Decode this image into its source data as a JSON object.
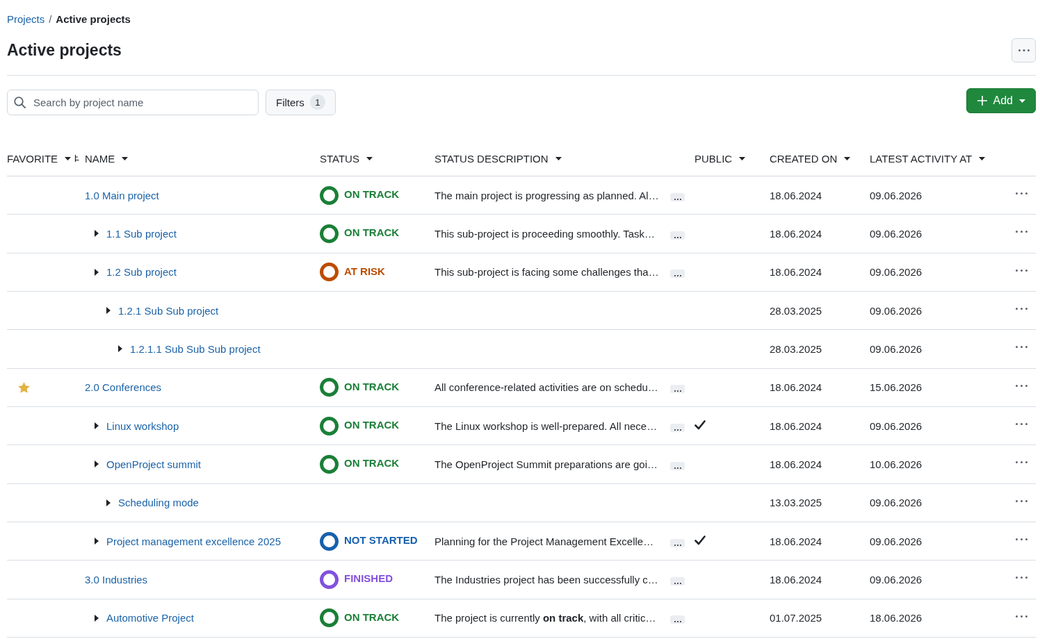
{
  "breadcrumb": {
    "parent": "Projects",
    "separator": "/",
    "current": "Active projects"
  },
  "title": "Active projects",
  "search": {
    "placeholder": "Search by project name"
  },
  "filters": {
    "label": "Filters",
    "count": "1"
  },
  "add_button": {
    "label": "Add"
  },
  "columns": [
    {
      "label": "FAVORITE"
    },
    {
      "label": "NAME"
    },
    {
      "label": "STATUS"
    },
    {
      "label": "STATUS DESCRIPTION"
    },
    {
      "label": "PUBLIC"
    },
    {
      "label": "CREATED ON"
    },
    {
      "label": "LATEST ACTIVITY AT"
    }
  ],
  "projects": [
    {
      "name": "1.0 Main project",
      "favorite": false,
      "status": {
        "label": "ON TRACK",
        "color": "#1a7f37"
      },
      "description": "The main project is progressing as planned. Al…",
      "public": false,
      "created_on": "18.06.2024",
      "latest_activity_at": "09.06.2026",
      "children": [
        {
          "name": "1.1 Sub project",
          "favorite": false,
          "status": {
            "label": "ON TRACK",
            "color": "#1a7f37"
          },
          "description": "This sub-project is proceeding smoothly. Task…",
          "public": false,
          "created_on": "18.06.2024",
          "latest_activity_at": "09.06.2026"
        },
        {
          "name": "1.2 Sub project",
          "favorite": false,
          "status": {
            "label": "AT RISK",
            "color": "#bc4c00"
          },
          "description": "This sub-project is facing some challenges tha…",
          "public": false,
          "created_on": "18.06.2024",
          "latest_activity_at": "09.06.2026",
          "children": [
            {
              "name": "1.2.1 Sub Sub project",
              "favorite": false,
              "public": false,
              "created_on": "28.03.2025",
              "latest_activity_at": "09.06.2026",
              "children": [
                {
                  "name": "1.2.1.1 Sub Sub Sub project",
                  "favorite": false,
                  "public": false,
                  "created_on": "28.03.2025",
                  "latest_activity_at": "09.06.2026"
                }
              ]
            }
          ]
        }
      ]
    },
    {
      "name": "2.0 Conferences",
      "favorite": true,
      "status": {
        "label": "ON TRACK",
        "color": "#1a7f37"
      },
      "description": "All conference-related activities are on schedu…",
      "public": false,
      "created_on": "18.06.2024",
      "latest_activity_at": "15.06.2026",
      "children": [
        {
          "name": "Linux workshop",
          "favorite": false,
          "status": {
            "label": "ON TRACK",
            "color": "#1a7f37"
          },
          "description": "The Linux workshop is well-prepared. All nece…",
          "public": true,
          "created_on": "18.06.2024",
          "latest_activity_at": "09.06.2026"
        },
        {
          "name": "OpenProject summit",
          "favorite": false,
          "status": {
            "label": "ON TRACK",
            "color": "#1a7f37"
          },
          "description": "The OpenProject Summit preparations are goi…",
          "public": false,
          "created_on": "18.06.2024",
          "latest_activity_at": "10.06.2026",
          "children": [
            {
              "name": "Scheduling mode",
              "favorite": false,
              "public": false,
              "created_on": "13.03.2025",
              "latest_activity_at": "09.06.2026"
            }
          ]
        },
        {
          "name": "Project management excellence 2025",
          "favorite": false,
          "status": {
            "label": "NOT STARTED",
            "color": "#1760ad"
          },
          "description": "Planning for the Project Management Excelle…",
          "public": true,
          "created_on": "18.06.2024",
          "latest_activity_at": "09.06.2026"
        }
      ]
    },
    {
      "name": "3.0 Industries",
      "favorite": false,
      "status": {
        "label": "FINISHED",
        "color": "#8250df"
      },
      "description": "The Industries project has been successfully c…",
      "public": false,
      "created_on": "18.06.2024",
      "latest_activity_at": "09.06.2026",
      "children": [
        {
          "name": "Automotive Project",
          "favorite": false,
          "status": {
            "label": "ON TRACK",
            "color": "#1a7f37"
          },
          "description": "The project is currently **on track**, with all critic…",
          "public": false,
          "created_on": "01.07.2025",
          "latest_activity_at": "18.06.2026"
        }
      ]
    }
  ]
}
